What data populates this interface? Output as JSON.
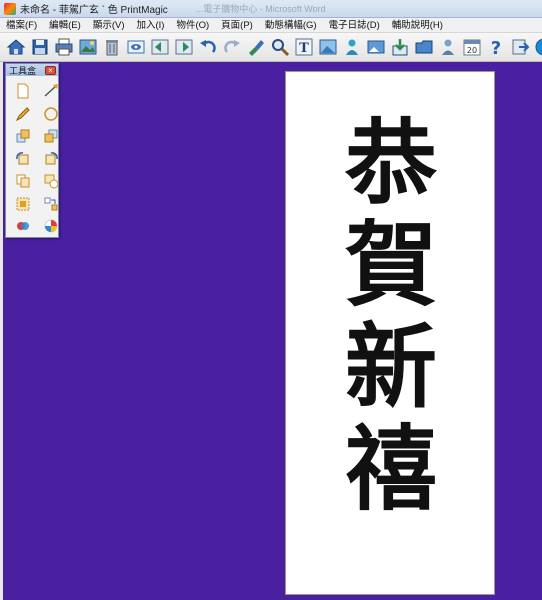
{
  "window": {
    "title": "未命名 - 菲駕广玄 `  色 PrintMagic",
    "background_title": "...電子購物中心 - Microsoft Word"
  },
  "menu": [
    {
      "label": "檔案(F)"
    },
    {
      "label": "編輯(E)"
    },
    {
      "label": "顯示(V)"
    },
    {
      "label": "加入(I)"
    },
    {
      "label": "物件(O)"
    },
    {
      "label": "頁面(P)"
    },
    {
      "label": "動態構幅(G)"
    },
    {
      "label": "電子日誌(D)"
    },
    {
      "label": "輔助說明(H)"
    }
  ],
  "toolbar": {
    "calendar_day": "20",
    "icons": [
      "home-icon",
      "save-icon",
      "print-icon",
      "image-icon",
      "trash-icon",
      "preview-icon",
      "align-left-icon",
      "align-right-icon",
      "undo-icon",
      "redo-icon",
      "paint-icon",
      "zoom-icon",
      "text-icon",
      "picture-icon",
      "person-icon",
      "photo-icon",
      "download-icon",
      "folder-icon",
      "user-icon",
      "calendar-icon",
      "help-icon",
      "export-icon",
      "play-icon"
    ]
  },
  "toolbox": {
    "title": "工具盒",
    "close_label": "×",
    "tools": [
      "new-page-icon",
      "line-icon",
      "pencil-icon",
      "circle-icon",
      "layer-up-icon",
      "layer-down-icon",
      "rotate-left-icon",
      "rotate-right-icon",
      "copy-icon",
      "group-icon",
      "crop-icon",
      "arrange-icon",
      "color-fill-icon",
      "color-wheel-icon"
    ]
  },
  "document": {
    "characters": [
      "恭",
      "賀",
      "新",
      "禧"
    ]
  },
  "colors": {
    "workspace": "#4a1fa0",
    "paper": "#ffffff",
    "ink": "#111111"
  }
}
